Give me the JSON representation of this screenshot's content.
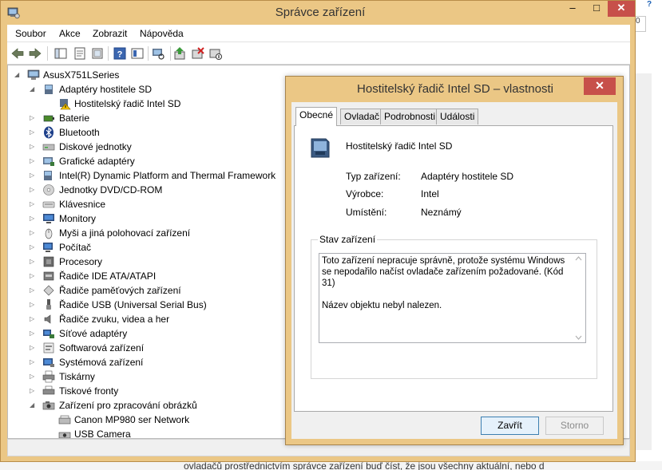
{
  "window": {
    "title": "Správce zařízení",
    "controls": {
      "minimize": "–",
      "maximize": "□",
      "close": "✕"
    }
  },
  "menu": [
    "Soubor",
    "Akce",
    "Zobrazit",
    "Nápověda"
  ],
  "toolbar": {
    "icons": [
      "back-icon",
      "forward-icon",
      "show-hide-tree-icon",
      "properties-icon",
      "details-icon",
      "help-icon",
      "action-view-icon",
      "scan-hardware-icon",
      "update-driver-icon",
      "uninstall-icon",
      "disable-icon"
    ]
  },
  "tree": {
    "root": "AsusX751LSeries",
    "items": [
      {
        "label": "Adaptéry hostitele SD",
        "expanded": true,
        "icon": "sd-adapter-icon"
      },
      {
        "label": "Hostitelský řadič Intel SD",
        "child": true,
        "warning": true,
        "icon": "warning-device-icon"
      },
      {
        "label": "Baterie",
        "icon": "battery-icon"
      },
      {
        "label": "Bluetooth",
        "icon": "bluetooth-icon"
      },
      {
        "label": "Diskové jednotky",
        "icon": "disk-drive-icon"
      },
      {
        "label": "Grafické adaptéry",
        "icon": "display-adapter-icon"
      },
      {
        "label": "Intel(R) Dynamic Platform and Thermal Framework",
        "icon": "thermal-icon"
      },
      {
        "label": "Jednotky DVD/CD-ROM",
        "icon": "dvd-icon"
      },
      {
        "label": "Klávesnice",
        "icon": "keyboard-icon"
      },
      {
        "label": "Monitory",
        "icon": "monitor-icon"
      },
      {
        "label": "Myši a jiná polohovací zařízení",
        "icon": "mouse-icon"
      },
      {
        "label": "Počítač",
        "icon": "computer-icon"
      },
      {
        "label": "Procesory",
        "icon": "processor-icon"
      },
      {
        "label": "Řadiče IDE ATA/ATAPI",
        "icon": "ide-icon"
      },
      {
        "label": "Řadiče paměťových zařízení",
        "icon": "storage-controller-icon"
      },
      {
        "label": "Řadiče USB (Universal Serial Bus)",
        "icon": "usb-icon"
      },
      {
        "label": "Řadiče zvuku, videa a her",
        "icon": "sound-icon"
      },
      {
        "label": "Síťové adaptéry",
        "icon": "network-icon"
      },
      {
        "label": "Softwarová zařízení",
        "icon": "software-device-icon"
      },
      {
        "label": "Systémová zařízení",
        "icon": "system-device-icon"
      },
      {
        "label": "Tiskárny",
        "icon": "printer-icon"
      },
      {
        "label": "Tiskové fronty",
        "icon": "print-queue-icon"
      },
      {
        "label": "Zařízení pro zpracování obrázků",
        "expanded": true,
        "icon": "imaging-icon"
      },
      {
        "label": "Canon MP980 ser Network",
        "child": true,
        "icon": "scanner-icon"
      },
      {
        "label": "USB Camera",
        "child": true,
        "icon": "camera-icon"
      }
    ]
  },
  "dialog": {
    "title": "Hostitelský řadič Intel SD – vlastnosti",
    "tabs": [
      "Obecné",
      "Ovladač",
      "Podrobnosti",
      "Události"
    ],
    "active_tab": "Obecné",
    "device_name": "Hostitelský řadič Intel SD",
    "props": [
      {
        "label": "Typ zařízení:",
        "value": "Adaptéry hostitele SD"
      },
      {
        "label": "Výrobce:",
        "value": "Intel"
      },
      {
        "label": "Umístění:",
        "value": "Neznámý"
      }
    ],
    "status_group": "Stav zařízení",
    "status_line1": "Toto zařízení nepracuje správně, protože systému Windows se nepodařilo načíst ovladače zařízením požadované. (Kód 31)",
    "status_line2": "Název objektu nebyl nalezen.",
    "ok_label": "Zavřít",
    "cancel_label": "Storno"
  },
  "background": {
    "help_glyph": "?",
    "box_text": "0",
    "footer_text": "ovladačů prostřednictvím správce zařízení buď číst, že jsou všechny aktuální, nebo d"
  }
}
